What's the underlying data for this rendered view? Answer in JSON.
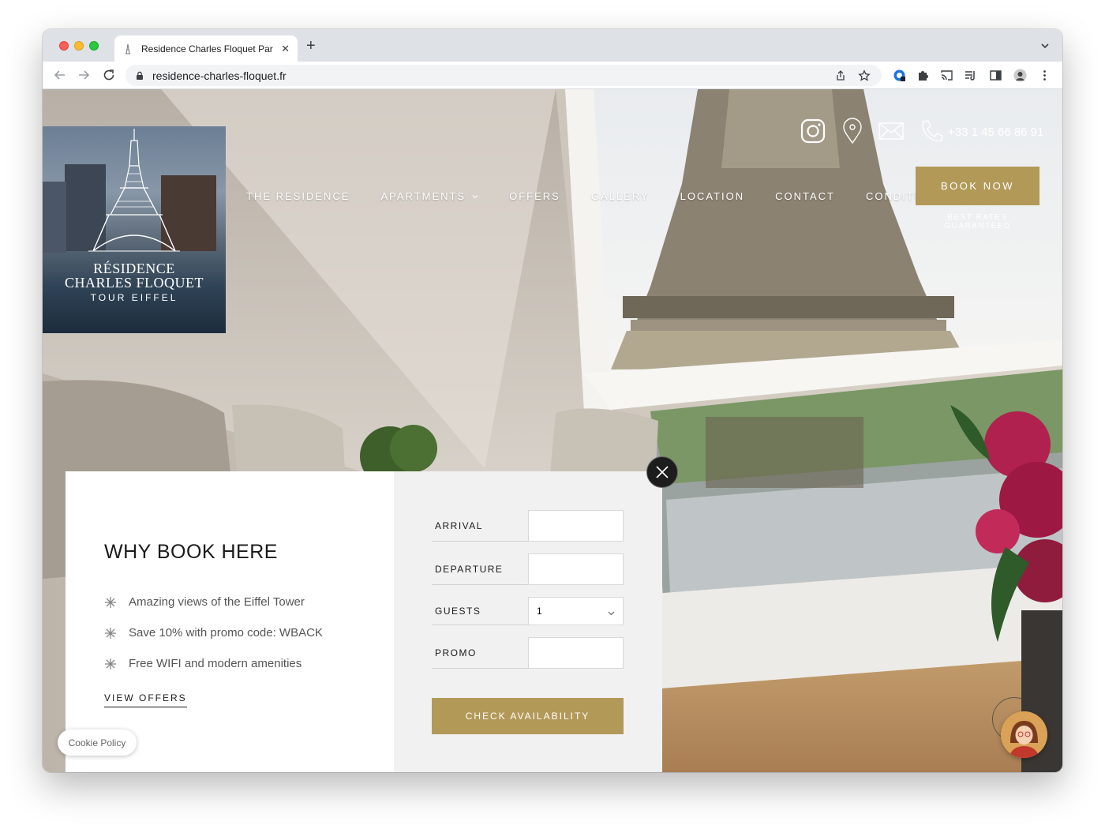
{
  "browser": {
    "tab_title": "Residence Charles Floquet Par",
    "url": "residence-charles-floquet.fr",
    "icons": [
      "tab-favicon-icon",
      "close-icon",
      "plus-icon",
      "chevron-down-icon",
      "back-icon",
      "forward-icon",
      "reload-icon",
      "lock-icon",
      "share-icon",
      "bookmark-star-icon",
      "extension-icon",
      "puzzle-icon",
      "cast-icon",
      "media-icon",
      "sidebar-icon",
      "profile-icon",
      "more-icon"
    ]
  },
  "logo": {
    "line1": "RÉSIDENCE",
    "line2": "CHARLES FLOQUET",
    "line3": "TOUR EIFFEL"
  },
  "header": {
    "phone": "+33 1 45 66 86 91",
    "icons": [
      "instagram-icon",
      "location-pin-icon",
      "mail-icon",
      "phone-icon"
    ]
  },
  "nav": {
    "items": [
      {
        "label": "THE RESIDENCE"
      },
      {
        "label": "APARTMENTS"
      },
      {
        "label": "OFFERS"
      },
      {
        "label": "GALLERY"
      },
      {
        "label": "LOCATION"
      },
      {
        "label": "CONTACT"
      },
      {
        "label": "CONDITIONS"
      }
    ]
  },
  "cta": {
    "book_now": "BOOK NOW",
    "best_rates": "BEST RATES GUARANTEED"
  },
  "why": {
    "title": "WHY BOOK HERE",
    "items": [
      {
        "text": "Amazing views of the Eiffel Tower"
      },
      {
        "text": "Save 10% with promo code: WBACK"
      },
      {
        "text": "Free WIFI and modern amenities"
      }
    ],
    "view_offers": "VIEW OFFERS"
  },
  "form": {
    "arrival_label": "ARRIVAL",
    "departure_label": "DEPARTURE",
    "guests_label": "GUESTS",
    "guests_value": "1",
    "promo_label": "PROMO",
    "submit": "CHECK AVAILABILITY"
  },
  "cookie": "Cookie Policy",
  "colors": {
    "accent_gold": "#b39958",
    "dark": "#1a1a1a"
  }
}
